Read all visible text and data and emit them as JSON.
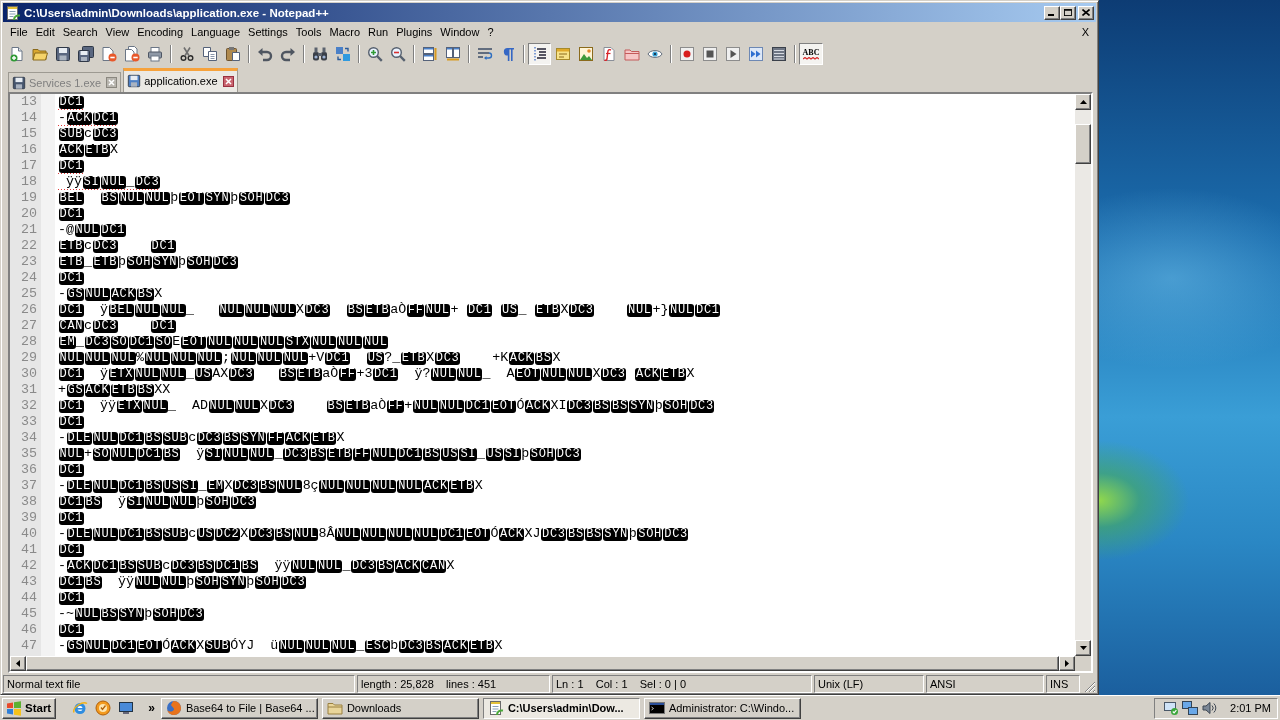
{
  "window": {
    "title": "C:\\Users\\admin\\Downloads\\application.exe - Notepad++"
  },
  "menu": {
    "items": [
      "File",
      "Edit",
      "Search",
      "View",
      "Encoding",
      "Language",
      "Settings",
      "Tools",
      "Macro",
      "Run",
      "Plugins",
      "Window",
      "?"
    ],
    "close_document": "X"
  },
  "toolbar": {
    "indent_guide": {
      "pressed": true
    },
    "spell_check": {
      "pressed": true,
      "label": "ABC"
    }
  },
  "tabs": [
    {
      "label": "Services 1.exe",
      "selected": false
    },
    {
      "label": "application.exe",
      "selected": true
    }
  ],
  "editor": {
    "lines": [
      {
        "number": "13",
        "misspelled": true,
        "segments": [
          {
            "kind": "control",
            "text": "DC1"
          }
        ]
      },
      {
        "number": "14",
        "misspelled": true,
        "segments": [
          {
            "kind": "text",
            "text": "-"
          },
          {
            "kind": "control",
            "text": "ACK"
          },
          {
            "kind": "control",
            "text": "DC1"
          }
        ]
      },
      {
        "number": "15",
        "misspelled": false,
        "segments": [
          {
            "kind": "control",
            "text": "SUB"
          },
          {
            "kind": "text",
            "text": "c"
          },
          {
            "kind": "control",
            "text": "DC3"
          }
        ]
      },
      {
        "number": "16",
        "misspelled": false,
        "segments": [
          {
            "kind": "control",
            "text": "ACK"
          },
          {
            "kind": "control",
            "text": "ETB"
          },
          {
            "kind": "text",
            "text": "X"
          }
        ]
      },
      {
        "number": "17",
        "misspelled": true,
        "segments": [
          {
            "kind": "control",
            "text": "DC1"
          }
        ]
      },
      {
        "number": "18",
        "misspelled": true,
        "segments": [
          {
            "kind": "text",
            "text": " ÿÿ"
          },
          {
            "kind": "control",
            "text": "SI"
          },
          {
            "kind": "control",
            "text": "NUL"
          },
          {
            "kind": "text",
            "text": "_"
          },
          {
            "kind": "control",
            "text": "DC3"
          }
        ]
      },
      {
        "number": "19",
        "misspelled": false,
        "segments": [
          {
            "kind": "control",
            "text": "BEL"
          },
          {
            "kind": "space"
          },
          {
            "kind": "space"
          },
          {
            "kind": "control",
            "text": "BS"
          },
          {
            "kind": "control",
            "text": "NUL"
          },
          {
            "kind": "control",
            "text": "NUL"
          },
          {
            "kind": "text",
            "text": "þ"
          },
          {
            "kind": "control",
            "text": "EOT"
          },
          {
            "kind": "control",
            "text": "SYN"
          },
          {
            "kind": "text",
            "text": "þ"
          },
          {
            "kind": "control",
            "text": "SOH"
          },
          {
            "kind": "control",
            "text": "DC3"
          }
        ]
      },
      {
        "number": "20",
        "misspelled": false,
        "segments": [
          {
            "kind": "control",
            "text": "DC1"
          }
        ]
      },
      {
        "number": "21",
        "misspelled": false,
        "segments": [
          {
            "kind": "text",
            "text": "-@"
          },
          {
            "kind": "control",
            "text": "NUL"
          },
          {
            "kind": "control",
            "text": "DC1"
          }
        ]
      },
      {
        "number": "22",
        "misspelled": false,
        "segments": [
          {
            "kind": "control",
            "text": "ETB"
          },
          {
            "kind": "text",
            "text": "c"
          },
          {
            "kind": "control",
            "text": "DC3"
          },
          {
            "kind": "space"
          },
          {
            "kind": "space"
          },
          {
            "kind": "space"
          },
          {
            "kind": "space"
          },
          {
            "kind": "control",
            "text": "DC1"
          }
        ]
      },
      {
        "number": "23",
        "misspelled": false,
        "segments": [
          {
            "kind": "control",
            "text": "ETB"
          },
          {
            "kind": "text",
            "text": "_"
          },
          {
            "kind": "control",
            "text": "ETB"
          },
          {
            "kind": "text",
            "text": "þ"
          },
          {
            "kind": "control",
            "text": "SOH"
          },
          {
            "kind": "control",
            "text": "SYN"
          },
          {
            "kind": "text",
            "text": "þ"
          },
          {
            "kind": "control",
            "text": "SOH"
          },
          {
            "kind": "control",
            "text": "DC3"
          }
        ]
      },
      {
        "number": "24",
        "misspelled": false,
        "segments": [
          {
            "kind": "control",
            "text": "DC1"
          }
        ]
      },
      {
        "number": "25",
        "misspelled": false,
        "segments": [
          {
            "kind": "text",
            "text": "-"
          },
          {
            "kind": "control",
            "text": "GS"
          },
          {
            "kind": "control",
            "text": "NUL"
          },
          {
            "kind": "control",
            "text": "ACK"
          },
          {
            "kind": "control",
            "text": "BS"
          },
          {
            "kind": "text",
            "text": "X"
          }
        ]
      },
      {
        "number": "26",
        "misspelled": false,
        "segments": [
          {
            "kind": "control",
            "text": "DC1"
          },
          {
            "kind": "text",
            "text": "  ÿ"
          },
          {
            "kind": "control",
            "text": "BEL"
          },
          {
            "kind": "control",
            "text": "NUL"
          },
          {
            "kind": "control",
            "text": "NUL"
          },
          {
            "kind": "text",
            "text": "_   "
          },
          {
            "kind": "control",
            "text": "NUL"
          },
          {
            "kind": "control",
            "text": "NUL"
          },
          {
            "kind": "control",
            "text": "NUL"
          },
          {
            "kind": "text",
            "text": "X"
          },
          {
            "kind": "control",
            "text": "DC3"
          },
          {
            "kind": "space"
          },
          {
            "kind": "space"
          },
          {
            "kind": "control",
            "text": "BS"
          },
          {
            "kind": "control",
            "text": "ETB"
          },
          {
            "kind": "text",
            "text": "aÒ"
          },
          {
            "kind": "control",
            "text": "FF"
          },
          {
            "kind": "control",
            "text": "NUL"
          },
          {
            "kind": "text",
            "text": "+ "
          },
          {
            "kind": "control",
            "text": "DC1"
          },
          {
            "kind": "space"
          },
          {
            "kind": "control",
            "text": "US"
          },
          {
            "kind": "text",
            "text": "_ "
          },
          {
            "kind": "control",
            "text": "ETB"
          },
          {
            "kind": "text",
            "text": "X"
          },
          {
            "kind": "control",
            "text": "DC3"
          },
          {
            "kind": "space"
          },
          {
            "kind": "space"
          },
          {
            "kind": "space"
          },
          {
            "kind": "space"
          },
          {
            "kind": "control",
            "text": "NUL"
          },
          {
            "kind": "text",
            "text": "+}"
          },
          {
            "kind": "control",
            "text": "NUL"
          },
          {
            "kind": "control",
            "text": "DC1"
          }
        ]
      },
      {
        "number": "27",
        "misspelled": false,
        "segments": [
          {
            "kind": "control",
            "text": "CAN"
          },
          {
            "kind": "text",
            "text": "c"
          },
          {
            "kind": "control",
            "text": "DC3"
          },
          {
            "kind": "space"
          },
          {
            "kind": "space"
          },
          {
            "kind": "space"
          },
          {
            "kind": "space"
          },
          {
            "kind": "control",
            "text": "DC1"
          }
        ]
      },
      {
        "number": "28",
        "misspelled": false,
        "segments": [
          {
            "kind": "control",
            "text": "EM"
          },
          {
            "kind": "text",
            "text": "_"
          },
          {
            "kind": "control",
            "text": "DC3"
          },
          {
            "kind": "control",
            "text": "SO"
          },
          {
            "kind": "control",
            "text": "DC1"
          },
          {
            "kind": "control",
            "text": "SO"
          },
          {
            "kind": "text",
            "text": "E"
          },
          {
            "kind": "control",
            "text": "EOT"
          },
          {
            "kind": "control",
            "text": "NUL"
          },
          {
            "kind": "control",
            "text": "NUL"
          },
          {
            "kind": "control",
            "text": "NUL"
          },
          {
            "kind": "control",
            "text": "STX"
          },
          {
            "kind": "control",
            "text": "NUL"
          },
          {
            "kind": "control",
            "text": "NUL"
          },
          {
            "kind": "control",
            "text": "NUL"
          }
        ]
      },
      {
        "number": "29",
        "misspelled": false,
        "segments": [
          {
            "kind": "control",
            "text": "NUL"
          },
          {
            "kind": "control",
            "text": "NUL"
          },
          {
            "kind": "control",
            "text": "NUL"
          },
          {
            "kind": "text",
            "text": "%"
          },
          {
            "kind": "control",
            "text": "NUL"
          },
          {
            "kind": "control",
            "text": "NUL"
          },
          {
            "kind": "control",
            "text": "NUL"
          },
          {
            "kind": "text",
            "text": ";"
          },
          {
            "kind": "control",
            "text": "NUL"
          },
          {
            "kind": "control",
            "text": "NUL"
          },
          {
            "kind": "control",
            "text": "NUL"
          },
          {
            "kind": "text",
            "text": "+V"
          },
          {
            "kind": "control",
            "text": "DC1"
          },
          {
            "kind": "space"
          },
          {
            "kind": "space"
          },
          {
            "kind": "control",
            "text": "US"
          },
          {
            "kind": "text",
            "text": "?_"
          },
          {
            "kind": "control",
            "text": "ETB"
          },
          {
            "kind": "text",
            "text": "X"
          },
          {
            "kind": "control",
            "text": "DC3"
          },
          {
            "kind": "text",
            "text": "    +K"
          },
          {
            "kind": "control",
            "text": "ACK"
          },
          {
            "kind": "control",
            "text": "BS"
          },
          {
            "kind": "text",
            "text": "X"
          }
        ]
      },
      {
        "number": "30",
        "misspelled": false,
        "segments": [
          {
            "kind": "control",
            "text": "DC1"
          },
          {
            "kind": "text",
            "text": "  ÿ"
          },
          {
            "kind": "control",
            "text": "ETX"
          },
          {
            "kind": "control",
            "text": "NUL"
          },
          {
            "kind": "control",
            "text": "NUL"
          },
          {
            "kind": "text",
            "text": "_"
          },
          {
            "kind": "control",
            "text": "US"
          },
          {
            "kind": "text",
            "text": "AX"
          },
          {
            "kind": "control",
            "text": "DC3"
          },
          {
            "kind": "space"
          },
          {
            "kind": "space"
          },
          {
            "kind": "space"
          },
          {
            "kind": "control",
            "text": "BS"
          },
          {
            "kind": "control",
            "text": "ETB"
          },
          {
            "kind": "text",
            "text": "aÒ"
          },
          {
            "kind": "control",
            "text": "FF"
          },
          {
            "kind": "text",
            "text": "+3"
          },
          {
            "kind": "control",
            "text": "DC1"
          },
          {
            "kind": "text",
            "text": "  ÿ?"
          },
          {
            "kind": "control",
            "text": "NUL"
          },
          {
            "kind": "control",
            "text": "NUL"
          },
          {
            "kind": "text",
            "text": "_  A"
          },
          {
            "kind": "control",
            "text": "EOT"
          },
          {
            "kind": "control",
            "text": "NUL"
          },
          {
            "kind": "control",
            "text": "NUL"
          },
          {
            "kind": "text",
            "text": "X"
          },
          {
            "kind": "control",
            "text": "DC3"
          },
          {
            "kind": "space"
          },
          {
            "kind": "control",
            "text": "ACK"
          },
          {
            "kind": "control",
            "text": "ETB"
          },
          {
            "kind": "text",
            "text": "X"
          }
        ]
      },
      {
        "number": "31",
        "misspelled": false,
        "segments": [
          {
            "kind": "text",
            "text": "+"
          },
          {
            "kind": "control",
            "text": "GS"
          },
          {
            "kind": "control",
            "text": "ACK"
          },
          {
            "kind": "control",
            "text": "ETB"
          },
          {
            "kind": "control",
            "text": "BS"
          },
          {
            "kind": "text",
            "text": "XX"
          }
        ]
      },
      {
        "number": "32",
        "misspelled": false,
        "segments": [
          {
            "kind": "control",
            "text": "DC1"
          },
          {
            "kind": "text",
            "text": "  ÿÿ"
          },
          {
            "kind": "control",
            "text": "ETX"
          },
          {
            "kind": "control",
            "text": "NUL"
          },
          {
            "kind": "text",
            "text": "_  AD"
          },
          {
            "kind": "control",
            "text": "NUL"
          },
          {
            "kind": "control",
            "text": "NUL"
          },
          {
            "kind": "text",
            "text": "X"
          },
          {
            "kind": "control",
            "text": "DC3"
          },
          {
            "kind": "space"
          },
          {
            "kind": "space"
          },
          {
            "kind": "space"
          },
          {
            "kind": "space"
          },
          {
            "kind": "control",
            "text": "BS"
          },
          {
            "kind": "control",
            "text": "ETB"
          },
          {
            "kind": "text",
            "text": "aÒ"
          },
          {
            "kind": "control",
            "text": "FF"
          },
          {
            "kind": "text",
            "text": "+"
          },
          {
            "kind": "control",
            "text": "NUL"
          },
          {
            "kind": "control",
            "text": "NUL"
          },
          {
            "kind": "control",
            "text": "DC1"
          },
          {
            "kind": "control",
            "text": "EOT"
          },
          {
            "kind": "text",
            "text": "Ó"
          },
          {
            "kind": "control",
            "text": "ACK"
          },
          {
            "kind": "text",
            "text": "XI"
          },
          {
            "kind": "control",
            "text": "DC3"
          },
          {
            "kind": "control",
            "text": "BS"
          },
          {
            "kind": "control",
            "text": "BS"
          },
          {
            "kind": "control",
            "text": "SYN"
          },
          {
            "kind": "text",
            "text": "þ"
          },
          {
            "kind": "control",
            "text": "SOH"
          },
          {
            "kind": "control",
            "text": "DC3"
          }
        ]
      },
      {
        "number": "33",
        "misspelled": false,
        "segments": [
          {
            "kind": "control",
            "text": "DC1"
          }
        ]
      },
      {
        "number": "34",
        "misspelled": false,
        "segments": [
          {
            "kind": "text",
            "text": "-"
          },
          {
            "kind": "control",
            "text": "DLE"
          },
          {
            "kind": "control",
            "text": "NUL"
          },
          {
            "kind": "control",
            "text": "DC1"
          },
          {
            "kind": "control",
            "text": "BS"
          },
          {
            "kind": "control",
            "text": "SUB"
          },
          {
            "kind": "text",
            "text": "c"
          },
          {
            "kind": "control",
            "text": "DC3"
          },
          {
            "kind": "control",
            "text": "BS"
          },
          {
            "kind": "control",
            "text": "SYN"
          },
          {
            "kind": "control",
            "text": "FF"
          },
          {
            "kind": "control",
            "text": "ACK"
          },
          {
            "kind": "control",
            "text": "ETB"
          },
          {
            "kind": "text",
            "text": "X"
          }
        ]
      },
      {
        "number": "35",
        "misspelled": false,
        "segments": [
          {
            "kind": "control",
            "text": "NUL"
          },
          {
            "kind": "text",
            "text": "+"
          },
          {
            "kind": "control",
            "text": "SO"
          },
          {
            "kind": "control",
            "text": "NUL"
          },
          {
            "kind": "control",
            "text": "DC1"
          },
          {
            "kind": "control",
            "text": "BS"
          },
          {
            "kind": "text",
            "text": "  ÿ"
          },
          {
            "kind": "control",
            "text": "SI"
          },
          {
            "kind": "control",
            "text": "NUL"
          },
          {
            "kind": "control",
            "text": "NUL"
          },
          {
            "kind": "text",
            "text": "_"
          },
          {
            "kind": "control",
            "text": "DC3"
          },
          {
            "kind": "control",
            "text": "BS"
          },
          {
            "kind": "control",
            "text": "ETB"
          },
          {
            "kind": "control",
            "text": "FF"
          },
          {
            "kind": "control",
            "text": "NUL"
          },
          {
            "kind": "control",
            "text": "DC1"
          },
          {
            "kind": "control",
            "text": "BS"
          },
          {
            "kind": "control",
            "text": "US"
          },
          {
            "kind": "control",
            "text": "SI"
          },
          {
            "kind": "text",
            "text": "_"
          },
          {
            "kind": "control",
            "text": "US"
          },
          {
            "kind": "control",
            "text": "SI"
          },
          {
            "kind": "text",
            "text": "þ"
          },
          {
            "kind": "control",
            "text": "SOH"
          },
          {
            "kind": "control",
            "text": "DC3"
          }
        ]
      },
      {
        "number": "36",
        "misspelled": false,
        "segments": [
          {
            "kind": "control",
            "text": "DC1"
          }
        ]
      },
      {
        "number": "37",
        "misspelled": false,
        "segments": [
          {
            "kind": "text",
            "text": "-"
          },
          {
            "kind": "control",
            "text": "DLE"
          },
          {
            "kind": "control",
            "text": "NUL"
          },
          {
            "kind": "control",
            "text": "DC1"
          },
          {
            "kind": "control",
            "text": "BS"
          },
          {
            "kind": "control",
            "text": "US"
          },
          {
            "kind": "control",
            "text": "SI"
          },
          {
            "kind": "text",
            "text": "_"
          },
          {
            "kind": "control",
            "text": "EM"
          },
          {
            "kind": "text",
            "text": "X"
          },
          {
            "kind": "control",
            "text": "DC3"
          },
          {
            "kind": "control",
            "text": "BS"
          },
          {
            "kind": "control",
            "text": "NUL"
          },
          {
            "kind": "text",
            "text": "8ç"
          },
          {
            "kind": "control",
            "text": "NUL"
          },
          {
            "kind": "control",
            "text": "NUL"
          },
          {
            "kind": "control",
            "text": "NUL"
          },
          {
            "kind": "control",
            "text": "NUL"
          },
          {
            "kind": "control",
            "text": "ACK"
          },
          {
            "kind": "control",
            "text": "ETB"
          },
          {
            "kind": "text",
            "text": "X"
          }
        ]
      },
      {
        "number": "38",
        "misspelled": false,
        "segments": [
          {
            "kind": "control",
            "text": "DC1"
          },
          {
            "kind": "control",
            "text": "BS"
          },
          {
            "kind": "text",
            "text": "  ÿ"
          },
          {
            "kind": "control",
            "text": "SI"
          },
          {
            "kind": "control",
            "text": "NUL"
          },
          {
            "kind": "control",
            "text": "NUL"
          },
          {
            "kind": "text",
            "text": "þ"
          },
          {
            "kind": "control",
            "text": "SOH"
          },
          {
            "kind": "control",
            "text": "DC3"
          }
        ]
      },
      {
        "number": "39",
        "misspelled": false,
        "segments": [
          {
            "kind": "control",
            "text": "DC1"
          }
        ]
      },
      {
        "number": "40",
        "misspelled": false,
        "segments": [
          {
            "kind": "text",
            "text": "-"
          },
          {
            "kind": "control",
            "text": "DLE"
          },
          {
            "kind": "control",
            "text": "NUL"
          },
          {
            "kind": "control",
            "text": "DC1"
          },
          {
            "kind": "control",
            "text": "BS"
          },
          {
            "kind": "control",
            "text": "SUB"
          },
          {
            "kind": "text",
            "text": "c"
          },
          {
            "kind": "control",
            "text": "US"
          },
          {
            "kind": "control",
            "text": "DC2"
          },
          {
            "kind": "text",
            "text": "X"
          },
          {
            "kind": "control",
            "text": "DC3"
          },
          {
            "kind": "control",
            "text": "BS"
          },
          {
            "kind": "control",
            "text": "NUL"
          },
          {
            "kind": "text",
            "text": "8Â"
          },
          {
            "kind": "control",
            "text": "NUL"
          },
          {
            "kind": "control",
            "text": "NUL"
          },
          {
            "kind": "control",
            "text": "NUL"
          },
          {
            "kind": "control",
            "text": "NUL"
          },
          {
            "kind": "control",
            "text": "DC1"
          },
          {
            "kind": "control",
            "text": "EOT"
          },
          {
            "kind": "text",
            "text": "Ó"
          },
          {
            "kind": "control",
            "text": "ACK"
          },
          {
            "kind": "text",
            "text": "XJ"
          },
          {
            "kind": "control",
            "text": "DC3"
          },
          {
            "kind": "control",
            "text": "BS"
          },
          {
            "kind": "control",
            "text": "BS"
          },
          {
            "kind": "control",
            "text": "SYN"
          },
          {
            "kind": "text",
            "text": "þ"
          },
          {
            "kind": "control",
            "text": "SOH"
          },
          {
            "kind": "control",
            "text": "DC3"
          }
        ]
      },
      {
        "number": "41",
        "misspelled": false,
        "segments": [
          {
            "kind": "control",
            "text": "DC1"
          }
        ]
      },
      {
        "number": "42",
        "misspelled": false,
        "segments": [
          {
            "kind": "text",
            "text": "-"
          },
          {
            "kind": "control",
            "text": "ACK"
          },
          {
            "kind": "control",
            "text": "DC1"
          },
          {
            "kind": "control",
            "text": "BS"
          },
          {
            "kind": "control",
            "text": "SUB"
          },
          {
            "kind": "text",
            "text": "c"
          },
          {
            "kind": "control",
            "text": "DC3"
          },
          {
            "kind": "control",
            "text": "BS"
          },
          {
            "kind": "control",
            "text": "DC1"
          },
          {
            "kind": "control",
            "text": "BS"
          },
          {
            "kind": "text",
            "text": "  ÿÿ"
          },
          {
            "kind": "control",
            "text": "NUL"
          },
          {
            "kind": "control",
            "text": "NUL"
          },
          {
            "kind": "text",
            "text": "_"
          },
          {
            "kind": "control",
            "text": "DC3"
          },
          {
            "kind": "control",
            "text": "BS"
          },
          {
            "kind": "control",
            "text": "ACK"
          },
          {
            "kind": "control",
            "text": "CAN"
          },
          {
            "kind": "text",
            "text": "X"
          }
        ]
      },
      {
        "number": "43",
        "misspelled": false,
        "segments": [
          {
            "kind": "control",
            "text": "DC1"
          },
          {
            "kind": "control",
            "text": "BS"
          },
          {
            "kind": "text",
            "text": "  ÿÿ"
          },
          {
            "kind": "control",
            "text": "NUL"
          },
          {
            "kind": "control",
            "text": "NUL"
          },
          {
            "kind": "text",
            "text": "þ"
          },
          {
            "kind": "control",
            "text": "SOH"
          },
          {
            "kind": "control",
            "text": "SYN"
          },
          {
            "kind": "text",
            "text": "þ"
          },
          {
            "kind": "control",
            "text": "SOH"
          },
          {
            "kind": "control",
            "text": "DC3"
          }
        ]
      },
      {
        "number": "44",
        "misspelled": false,
        "segments": [
          {
            "kind": "control",
            "text": "DC1"
          }
        ]
      },
      {
        "number": "45",
        "misspelled": false,
        "segments": [
          {
            "kind": "text",
            "text": "-~"
          },
          {
            "kind": "control",
            "text": "NUL"
          },
          {
            "kind": "control",
            "text": "BS"
          },
          {
            "kind": "control",
            "text": "SYN"
          },
          {
            "kind": "text",
            "text": "þ"
          },
          {
            "kind": "control",
            "text": "SOH"
          },
          {
            "kind": "control",
            "text": "DC3"
          }
        ]
      },
      {
        "number": "46",
        "misspelled": false,
        "segments": [
          {
            "kind": "control",
            "text": "DC1"
          }
        ]
      },
      {
        "number": "47",
        "misspelled": false,
        "segments": [
          {
            "kind": "text",
            "text": "-"
          },
          {
            "kind": "control",
            "text": "GS"
          },
          {
            "kind": "control",
            "text": "NUL"
          },
          {
            "kind": "control",
            "text": "DC1"
          },
          {
            "kind": "control",
            "text": "EOT"
          },
          {
            "kind": "text",
            "text": "Ó"
          },
          {
            "kind": "control",
            "text": "ACK"
          },
          {
            "kind": "text",
            "text": "X"
          },
          {
            "kind": "control",
            "text": "SUB"
          },
          {
            "kind": "text",
            "text": "ÓYJ  ü"
          },
          {
            "kind": "control",
            "text": "NUL"
          },
          {
            "kind": "control",
            "text": "NUL"
          },
          {
            "kind": "control",
            "text": "NUL"
          },
          {
            "kind": "text",
            "text": "_"
          },
          {
            "kind": "control",
            "text": "ESC"
          },
          {
            "kind": "text",
            "text": "b"
          },
          {
            "kind": "control",
            "text": "DC3"
          },
          {
            "kind": "control",
            "text": "BS"
          },
          {
            "kind": "control",
            "text": "ACK"
          },
          {
            "kind": "control",
            "text": "ETB"
          },
          {
            "kind": "text",
            "text": "X"
          }
        ]
      }
    ]
  },
  "status_bar": {
    "file_type": "Normal text file",
    "document_stats": "length : 25,828    lines : 451",
    "caret_position": "Ln : 1    Col : 1    Sel : 0 | 0",
    "eol": "Unix (LF)",
    "encoding": "ANSI",
    "mode": "INS"
  },
  "taskbar": {
    "start": "Start",
    "more": "»",
    "tasks": [
      {
        "kind": "browser",
        "label": "Base64 to File | Base64 ...",
        "selected": false
      },
      {
        "kind": "folder",
        "label": "Downloads",
        "selected": false
      },
      {
        "kind": "editor",
        "label": "C:\\Users\\admin\\Dow...",
        "selected": true
      },
      {
        "kind": "console",
        "label": "Administrator: C:\\Windo...",
        "selected": false
      }
    ],
    "clock": "2:01 PM"
  }
}
